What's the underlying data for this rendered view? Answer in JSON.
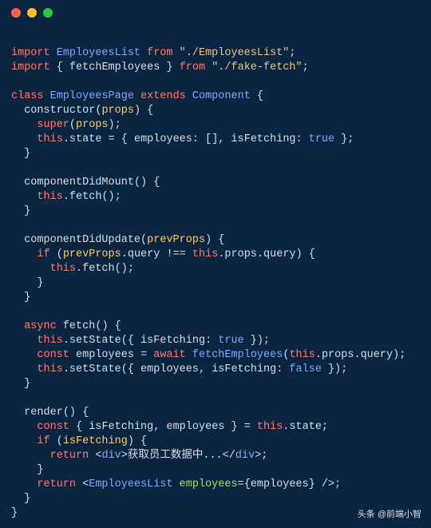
{
  "code": {
    "lines": [
      "",
      "import EmployeesList from \"./EmployeesList\";",
      "import { fetchEmployees } from \"./fake-fetch\";",
      "",
      "class EmployeesPage extends Component {",
      "  constructor(props) {",
      "    super(props);",
      "    this.state = { employees: [], isFetching: true };",
      "  }",
      "",
      "  componentDidMount() {",
      "    this.fetch();",
      "  }",
      "",
      "  componentDidUpdate(prevProps) {",
      "    if (prevProps.query !== this.props.query) {",
      "      this.fetch();",
      "    }",
      "  }",
      "",
      "  async fetch() {",
      "    this.setState({ isFetching: true });",
      "    const employees = await fetchEmployees(this.props.query);",
      "    this.setState({ employees, isFetching: false });",
      "  }",
      "",
      "  render() {",
      "    const { isFetching, employees } = this.state;",
      "    if (isFetching) {",
      "      return <div>获取员工数据中...</div>;",
      "    }",
      "    return <EmployeesList employees={employees} />;",
      "  }",
      "}"
    ]
  },
  "watermark": {
    "prefix": "头条",
    "handle": "@前端小智"
  },
  "traffic": {
    "red": "#ff5f56",
    "yellow": "#ffbd2e",
    "green": "#27c93f"
  }
}
